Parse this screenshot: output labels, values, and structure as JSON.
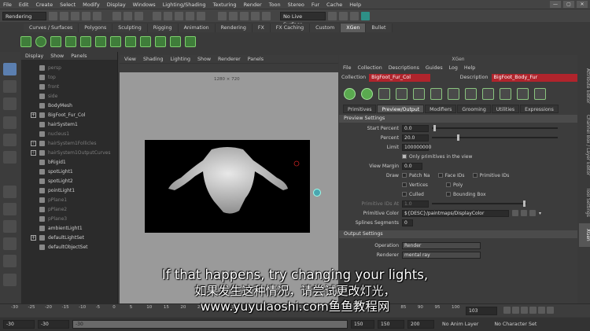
{
  "menubar": {
    "items": [
      "File",
      "Edit",
      "Create",
      "Select",
      "Modify",
      "Display",
      "Windows",
      "Lighting/Shading",
      "Texturing",
      "Render",
      "Toon",
      "Stereo",
      "Fur",
      "Cache",
      "Help"
    ]
  },
  "statusline": {
    "mode": "Rendering",
    "live_surface": "No Live Surface"
  },
  "shelf": {
    "tabs": [
      "Curves / Surfaces",
      "Polygons",
      "Sculpting",
      "Rigging",
      "Animation",
      "Rendering",
      "FX",
      "FX Caching",
      "Custom",
      "XGen",
      "Bullet"
    ],
    "active_tab": "XGen"
  },
  "outliner": {
    "menu": [
      "Display",
      "Show",
      "Panels"
    ],
    "items": [
      {
        "label": "persp",
        "dim": true,
        "expand": false
      },
      {
        "label": "top",
        "dim": true,
        "expand": false
      },
      {
        "label": "front",
        "dim": true,
        "expand": false
      },
      {
        "label": "side",
        "dim": true,
        "expand": false
      },
      {
        "label": "BodyMesh",
        "dim": false,
        "expand": false
      },
      {
        "label": "BigFoot_Fur_Col",
        "dim": false,
        "expand": true
      },
      {
        "label": "hairSystem1",
        "dim": false,
        "expand": false
      },
      {
        "label": "nucleus1",
        "dim": true,
        "expand": false
      },
      {
        "label": "hairSystem1Follicles",
        "dim": true,
        "expand": true
      },
      {
        "label": "hairSystem1OutputCurves",
        "dim": true,
        "expand": true
      },
      {
        "label": "bRigid1",
        "dim": false,
        "expand": false
      },
      {
        "label": "spotLight1",
        "dim": false,
        "expand": false
      },
      {
        "label": "spotLight2",
        "dim": false,
        "expand": false
      },
      {
        "label": "pointLight1",
        "dim": false,
        "expand": false
      },
      {
        "label": "pPlane1",
        "dim": true,
        "expand": false
      },
      {
        "label": "pPlane2",
        "dim": true,
        "expand": false
      },
      {
        "label": "pPlane3",
        "dim": true,
        "expand": false
      },
      {
        "label": "ambientLight1",
        "dim": false,
        "expand": false
      },
      {
        "label": "defaultLightSet",
        "dim": false,
        "expand": true
      },
      {
        "label": "defaultObjectSet",
        "dim": false,
        "expand": false
      }
    ]
  },
  "viewport": {
    "menu": [
      "View",
      "Shading",
      "Lighting",
      "Show",
      "Renderer",
      "Panels"
    ],
    "resolution": "1280 × 720"
  },
  "xgen": {
    "title": "XGen",
    "menu": [
      "File",
      "Collection",
      "Descriptions",
      "Guides",
      "Log",
      "Help"
    ],
    "collection_label": "Collection",
    "collection_value": "BigFoot_Fur_Col",
    "description_label": "Description",
    "description_value": "BigFoot_Body_Fur",
    "tabs": [
      "Primitives",
      "Preview/Output",
      "Modifiers",
      "Grooming",
      "Utilities",
      "Expressions"
    ],
    "active_tab": "Preview/Output",
    "preview_section": "Preview Settings",
    "output_section": "Output Settings",
    "fields": {
      "start_percent": {
        "label": "Start Percent",
        "value": "0.0"
      },
      "percent": {
        "label": "Percent",
        "value": "20.0"
      },
      "limit": {
        "label": "Limit",
        "value": "100000000"
      },
      "only_primitives": "Only primitives in the view",
      "view_margin": {
        "label": "View Margin",
        "value": "0.0"
      },
      "draw_label": "Draw",
      "draw_options": [
        "Patch Na",
        "Face IDs",
        "Primitive IDs",
        "Vertices",
        "Poly",
        "Culled",
        "Bounding Box"
      ],
      "primitive_ids_at": {
        "label": "Primitive IDs At",
        "value": "1.0"
      },
      "primitive_color": {
        "label": "Primitive Color",
        "value": "${DESC}/paintmaps/DisplayColor"
      },
      "splines_segments": {
        "label": "Splines Segments",
        "value": "0"
      },
      "operation": {
        "label": "Operation",
        "value": "Render"
      },
      "renderer": {
        "label": "Renderer",
        "value": "mental ray"
      }
    }
  },
  "sidetabs": [
    "Attribute Editor",
    "Channel Box / Layer Editor",
    "Tool Settings",
    "XGen"
  ],
  "timeline": {
    "ticks": [
      "-30",
      "-25",
      "-20",
      "-15",
      "-10",
      "-5",
      "0",
      "5",
      "10",
      "15",
      "20",
      "25",
      "30",
      "35",
      "40",
      "45",
      "50",
      "55",
      "60",
      "65",
      "70",
      "75",
      "80",
      "85",
      "90",
      "95",
      "100"
    ],
    "current_frame": "103"
  },
  "range": {
    "start": "-30",
    "playback_start": "-30",
    "range_start": "-30",
    "range_end": "150",
    "playback_end": "150",
    "end": "200",
    "anim_layer": "No Anim Layer",
    "character_set": "No Character Set"
  },
  "subtitles": {
    "english": "If that happens, try changing your lights,",
    "chinese": "如果发生这种情况，请尝试更改灯光，",
    "watermark": "www.yuyulaoshi.com鱼鱼教程网"
  }
}
